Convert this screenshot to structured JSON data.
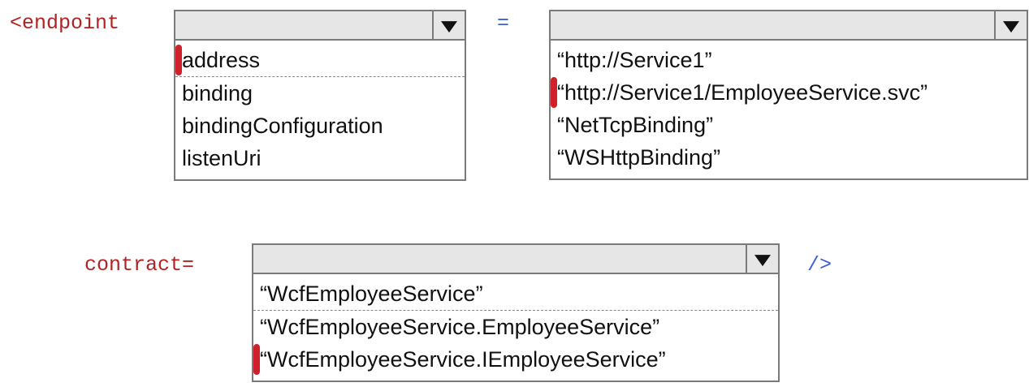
{
  "code": {
    "endpoint_open": "<endpoint",
    "equals": "=",
    "contract_label": "contract=",
    "close_tag": "/>"
  },
  "dropdowns": {
    "attribute": {
      "options": [
        "address",
        "binding",
        "bindingConfiguration",
        "listenUri"
      ],
      "selected_index": 0
    },
    "value": {
      "options": [
        "“http://Service1”",
        "“http://Service1/EmployeeService.svc”",
        "“NetTcpBinding”",
        "“WSHttpBinding”"
      ],
      "selected_index": 1
    },
    "contract": {
      "options": [
        "“WcfEmployeeService”",
        "“WcfEmployeeService.EmployeeService”",
        "“WcfEmployeeService.IEmployeeService”"
      ],
      "selected_index": 2
    }
  },
  "colors": {
    "highlight": "#d0202c",
    "tag_red": "#b22222",
    "syntax_blue": "#3b5fd6"
  }
}
